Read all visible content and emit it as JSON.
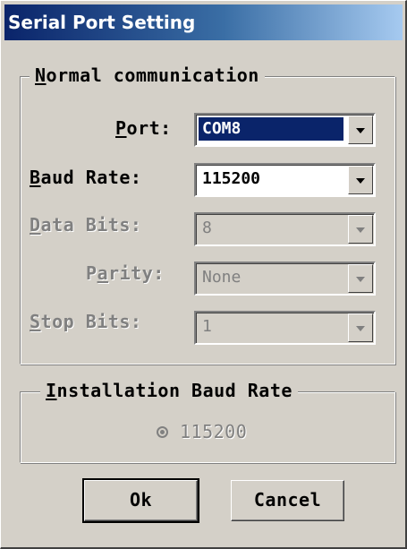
{
  "window": {
    "title": "Serial Port Setting"
  },
  "normal_group": {
    "title": "Normal communication",
    "port": {
      "label": "Port:",
      "value": "COM8"
    },
    "baud_rate": {
      "label": "Baud Rate:",
      "value": "115200"
    },
    "data_bits": {
      "label": "Data Bits:",
      "value": "8"
    },
    "parity": {
      "label": "Parity:",
      "value": "None"
    },
    "stop_bits": {
      "label": "Stop Bits:",
      "value": "1"
    }
  },
  "install_group": {
    "title": "Installation Baud Rate",
    "option_label": "115200"
  },
  "buttons": {
    "ok": "Ok",
    "cancel": "Cancel"
  }
}
